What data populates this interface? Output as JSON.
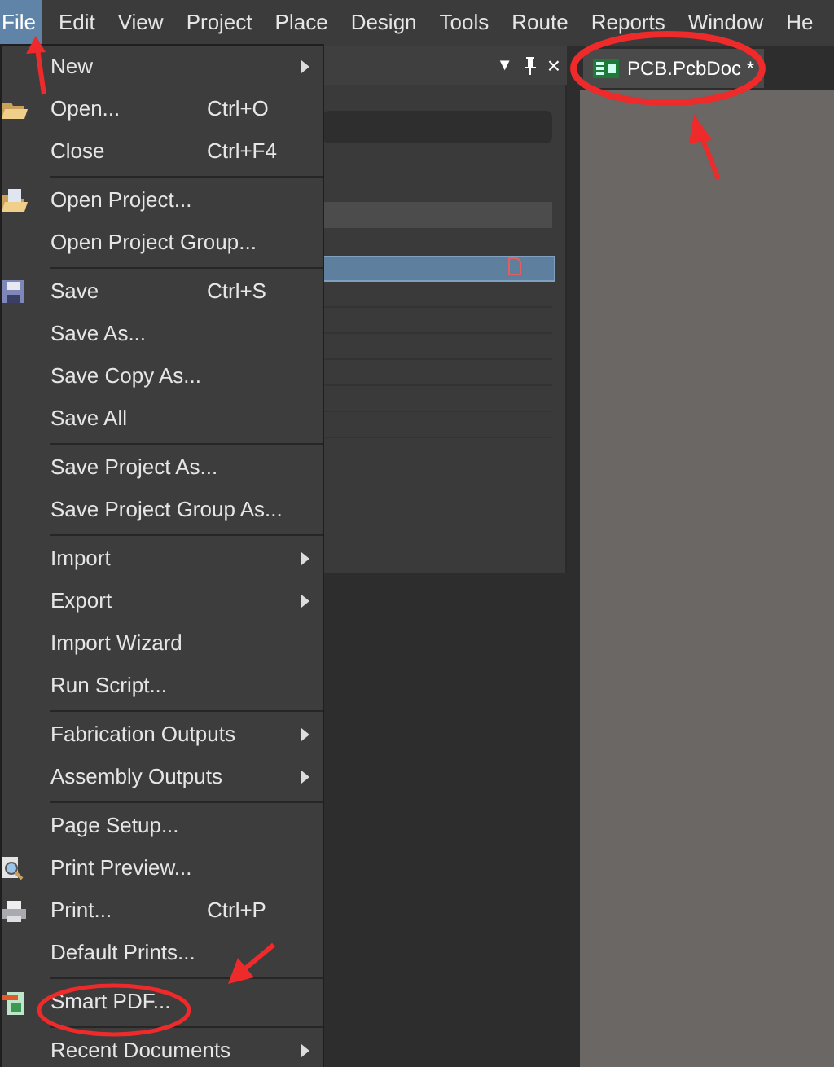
{
  "menubar": [
    {
      "label": "File",
      "selected": true
    },
    {
      "label": "Edit",
      "selected": false
    },
    {
      "label": "View",
      "selected": false
    },
    {
      "label": "Project",
      "selected": false
    },
    {
      "label": "Place",
      "selected": false
    },
    {
      "label": "Design",
      "selected": false
    },
    {
      "label": "Tools",
      "selected": false
    },
    {
      "label": "Route",
      "selected": false
    },
    {
      "label": "Reports",
      "selected": false
    },
    {
      "label": "Window",
      "selected": false
    },
    {
      "label": "He",
      "selected": false
    }
  ],
  "panel_header": {
    "dropdown": "▼",
    "close": "×"
  },
  "document_tab": {
    "label": "PCB.PcbDoc *",
    "selected": true
  },
  "file_menu": [
    [
      {
        "label": "New",
        "submenu": true
      },
      {
        "label": "Open...",
        "shortcut": "Ctrl+O",
        "kind": "folder"
      },
      {
        "label": "Close",
        "shortcut": "Ctrl+F4"
      }
    ],
    [
      {
        "label": "Open Project...",
        "kind": "project"
      },
      {
        "label": "Open Project Group..."
      }
    ],
    [
      {
        "label": "Save",
        "shortcut": "Ctrl+S",
        "kind": "save"
      },
      {
        "label": "Save As..."
      },
      {
        "label": "Save Copy As..."
      },
      {
        "label": "Save All"
      }
    ],
    [
      {
        "label": "Save Project As..."
      },
      {
        "label": "Save Project Group As..."
      }
    ],
    [
      {
        "label": "Import",
        "submenu": true
      },
      {
        "label": "Export",
        "submenu": true
      },
      {
        "label": "Import Wizard"
      },
      {
        "label": "Run Script..."
      }
    ],
    [
      {
        "label": "Fabrication Outputs",
        "submenu": true
      },
      {
        "label": "Assembly Outputs",
        "submenu": true
      }
    ],
    [
      {
        "label": "Page Setup..."
      },
      {
        "label": "Print Preview...",
        "kind": "preview"
      },
      {
        "label": "Print...",
        "shortcut": "Ctrl+P",
        "kind": "printer"
      },
      {
        "label": "Default Prints..."
      }
    ],
    [
      {
        "label": "Smart PDF...",
        "kind": "pdf"
      }
    ],
    [
      {
        "label": "Recent Documents",
        "submenu": true
      }
    ]
  ]
}
